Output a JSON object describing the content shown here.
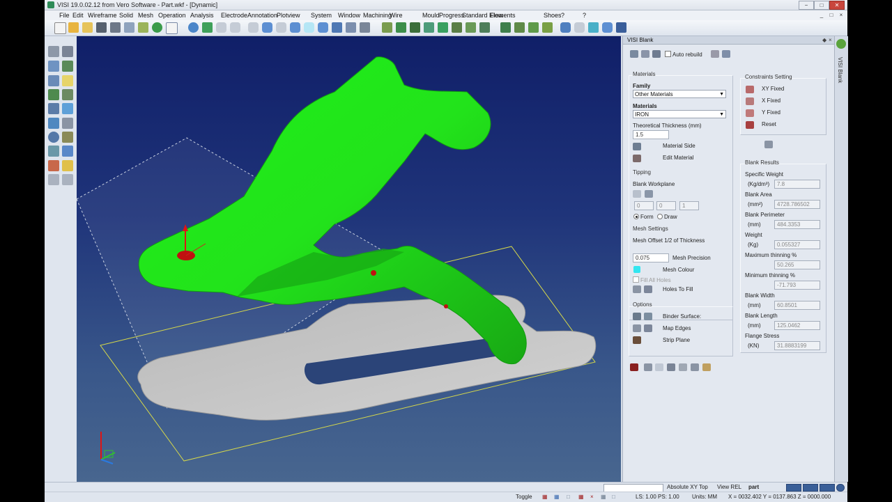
{
  "window": {
    "title": "VISI 19.0.02.12 from Vero Software - Part.wkf - [Dynamic]",
    "min": "−",
    "max": "□",
    "close": "✕"
  },
  "menu": [
    "File",
    "Edit",
    "Wireframe",
    "Solid",
    "Mesh",
    "Operation",
    "Analysis",
    "Electrode",
    "Annotation",
    "Plotview",
    "System",
    "Window",
    "Machining",
    "Wire",
    "Mould",
    "Progress",
    "Standard Elements",
    "Flow",
    "Shoes",
    "?"
  ],
  "panel": {
    "title": "VISI Blank",
    "auto_rebuild": "Auto rebuild",
    "materials": {
      "section": "Materials",
      "family_label": "Family",
      "family_value": "Other Materials",
      "materials_label": "Materials",
      "materials_value": "IRON",
      "thickness_label": "Theoretical Thickness (mm)",
      "thickness_value": "1.5",
      "material_side": "Material Side",
      "edit_material": "Edit Material"
    },
    "tipping": {
      "section": "Tipping",
      "workplane_label": "Blank Workplane",
      "v1": "0",
      "v2": "0",
      "v3": "1",
      "form": "Form",
      "draw": "Draw"
    },
    "mesh": {
      "section": "Mesh Settings",
      "offset_label": "Mesh Offset 1/2 of Thickness",
      "precision_value": "0.075",
      "precision_label": "Mesh Precision",
      "colour_label": "Mesh Colour",
      "colour": "#33e6f0",
      "fill_all_holes": "Fill All Holes",
      "holes_to_fill": "Holes To Fill"
    },
    "options": {
      "section": "Options",
      "binder": "Binder Surface:",
      "map_edges": "Map Edges",
      "strip_plane": "Strip Plane"
    },
    "constraints": {
      "section": "Constraints Setting",
      "xy_fixed": "XY Fixed",
      "x_fixed": "X Fixed",
      "y_fixed": "Y Fixed",
      "reset": "Reset"
    },
    "results": {
      "section": "Blank Results",
      "items": [
        {
          "label": "Specific Weight",
          "unit": "(Kg/dm³)",
          "value": "7.8"
        },
        {
          "label": "Blank Area",
          "unit": "(mm²)",
          "value": "4728.786502"
        },
        {
          "label": "Blank Perimeter",
          "unit": "(mm)",
          "value": "484.3353"
        },
        {
          "label": "Weight",
          "unit": "(Kg)",
          "value": "0.055327"
        },
        {
          "label": "Maximum thinning %",
          "unit": "",
          "value": "50.265"
        },
        {
          "label": "Minimum thinning %",
          "unit": "",
          "value": "-71.793"
        },
        {
          "label": "Blank Width",
          "unit": "(mm)",
          "value": "60.8501"
        },
        {
          "label": "Blank Length",
          "unit": "(mm)",
          "value": "125.0462"
        },
        {
          "label": "Flange Stress",
          "unit": "(KN)",
          "value": "31.8883199"
        }
      ]
    }
  },
  "sidetab": "VISI Blank",
  "status": {
    "view_mode": "Absolute XY Top",
    "view_rel": "View REL",
    "layer": "part",
    "toggle": "Toggle",
    "ls_ps": "LS: 1.00 PS: 1.00",
    "units": "Units: MM",
    "coords": "X = 0032.402 Y = 0137.863 Z = 0000.000"
  },
  "colors": {
    "part_green": "#22e31b",
    "blank_grey": "#c8c8c8",
    "viewport_top": "#101f68"
  }
}
